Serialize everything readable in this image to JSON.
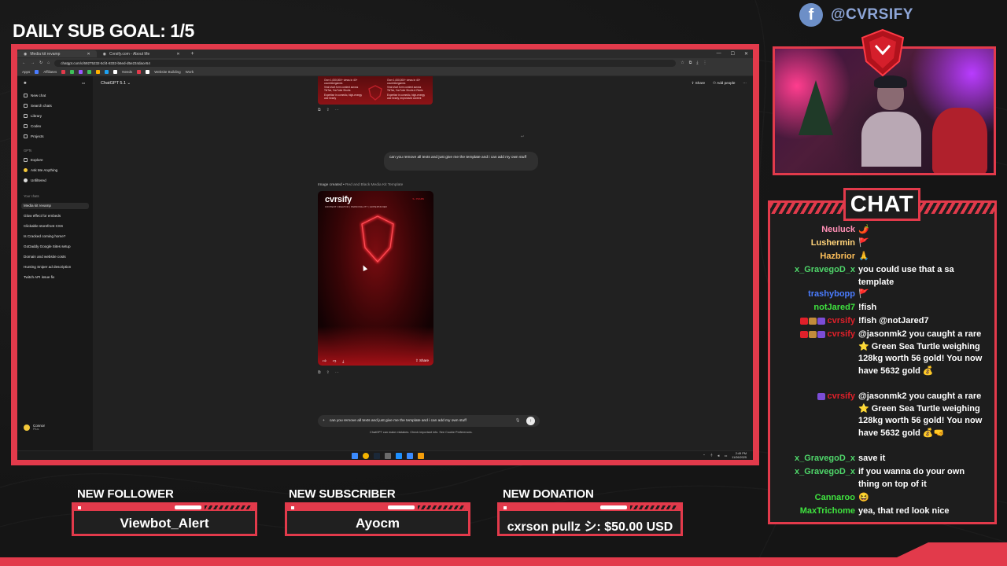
{
  "overlay": {
    "sub_goal": "DAILY SUB GOAL: 1/5",
    "social_handle": "@CVRSIFY",
    "social_icon": "facebook-icon",
    "accent_color": "#e23a4b",
    "chat_title": "CHAT",
    "alerts": [
      {
        "label": "NEW FOLLOWER",
        "value": "Viewbot_Alert"
      },
      {
        "label": "NEW SUBSCRIBER",
        "value": "Ayocm"
      },
      {
        "label": "NEW DONATION",
        "value": "cxrson pullz シ: $50.00 USD"
      }
    ]
  },
  "browser": {
    "tabs": [
      {
        "label": "Media kit revamp"
      },
      {
        "label": "Cvrsify.com - About Me"
      }
    ],
    "url": "chatgpt.com/c/69275232-5cf4-8332-b6ed-d5e234dace54",
    "bookmarks": [
      "Apps",
      "Affiliates",
      "Needs",
      "Website Building",
      "Work"
    ]
  },
  "chatgpt": {
    "model": "ChatGPT 5.1",
    "share": "Share",
    "add_people": "Add people",
    "sidebar": {
      "main": [
        "New chat",
        "Search chats",
        "Library",
        "Codex",
        "Projects"
      ],
      "gpts_heading": "GPTs",
      "gpts": [
        "Explore",
        "Ask Me Anything",
        "Unfiltered"
      ],
      "chats_heading": "Your chats",
      "chats": [
        "Media kit revamp",
        "Glow effect for embeds",
        "Clickable storefront CSS",
        "Is Cracked coming home?",
        "GoDaddy Google Sites setup",
        "Domain and website costs",
        "Hunting Sniper ad description",
        "Twitch API issue fix"
      ],
      "profile_name": "Connor",
      "profile_plan": "Plus"
    },
    "prev_image_text": [
      "Over 1,000,000+ views in 40+ countries/games",
      "Over 1,000,000+ views in 40+ countries/games",
      "Viral short form content across TikTok, YouTube Shorts",
      "Viral short form content across TikTok, YouTube Shorts & Reels",
      "Expertise in comedic, high-energy and hearty",
      "Expertise in comedic, high-energy and hearty, improvised content"
    ],
    "user_message": "can you remove all texts and just give me the template and i can add my own stuff",
    "image_caption_prefix": "Image created",
    "image_caption_title": "Red and Black Media Kit Template",
    "image": {
      "brand": "cvrsify",
      "tagline": "CONTENT CREATOR | PERSONALITY | ENTERTAINER",
      "tag": "5+ YEARS",
      "share": "Share"
    },
    "composer_text": "can you remove all texts and just give me the template and i can add my own stuff",
    "disclaimer": "ChatGPT can make mistakes. Check important info. See Cookie Preferences."
  },
  "taskbar": {
    "time": "2:49 PM",
    "date": "11/26/2025"
  },
  "chat": [
    {
      "name": "Neuluck",
      "name_color": "#ff8fb5",
      "badges": [],
      "text": "🌶️"
    },
    {
      "name": "Lushermin",
      "name_color": "#ffd37a",
      "badges": [],
      "text": "🚩"
    },
    {
      "name": "Hazbrior",
      "name_color": "#ffc05a",
      "badges": [],
      "text": "🙏"
    },
    {
      "name": "x_GravegoD_x",
      "name_color": "#4fd66a",
      "badges": [],
      "text": "you could use that a sa template"
    },
    {
      "name": "trashybopp",
      "name_color": "#4a7cff",
      "badges": [],
      "text": "🚩"
    },
    {
      "name": "notJared7",
      "name_color": "#3fe33f",
      "badges": [],
      "text": "!fish"
    },
    {
      "name": "cvrsify",
      "name_color": "#e0202a",
      "badges": [
        "#e0202a",
        "#c28b3b",
        "#7b4dd6"
      ],
      "text": "!fish @notJared7"
    },
    {
      "name": "cvrsify",
      "name_color": "#e0202a",
      "badges": [
        "#e0202a",
        "#c28b3b",
        "#7b4dd6"
      ],
      "text": "@jasonmk2 you caught a rare ⭐ Green Sea Turtle weighing 128kg worth 56 gold! You now have 5632 gold 💰"
    },
    {
      "name": "cvrsify",
      "name_color": "#e0202a",
      "badges": [
        "#7b4dd6"
      ],
      "text": "@jasonmk2 you caught a rare ⭐ Green Sea Turtle weighing 128kg worth 56 gold! You now have 5632 gold 💰🤜"
    },
    {
      "name": "x_GravegoD_x",
      "name_color": "#4fd66a",
      "badges": [],
      "text": "save it"
    },
    {
      "name": "x_GravegoD_x",
      "name_color": "#4fd66a",
      "badges": [],
      "text": "if you wanna do your own thing on top of it"
    },
    {
      "name": "Cannaroo",
      "name_color": "#3fe33f",
      "badges": [],
      "text": "😆"
    },
    {
      "name": "MaxTrichome",
      "name_color": "#3fe33f",
      "badges": [],
      "text": "yea, that red look nice"
    }
  ]
}
